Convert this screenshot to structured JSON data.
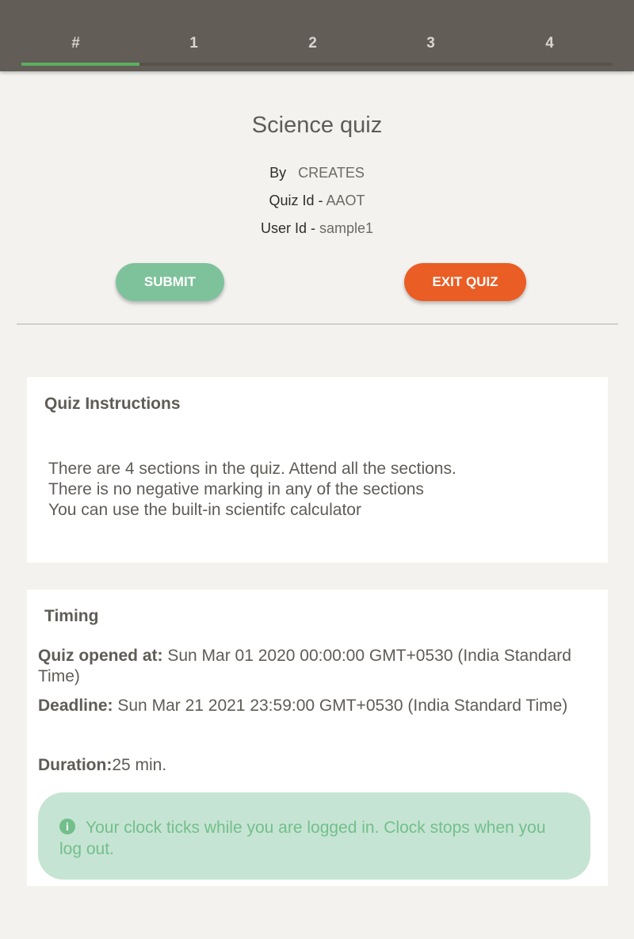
{
  "tabs": [
    {
      "label": "#",
      "active": true
    },
    {
      "label": "1",
      "active": false
    },
    {
      "label": "2",
      "active": false
    },
    {
      "label": "3",
      "active": false
    },
    {
      "label": "4",
      "active": false
    }
  ],
  "quiz": {
    "title": "Science quiz",
    "by_label": "By",
    "by_value": "CREATES",
    "quiz_id_label": "Quiz Id -",
    "quiz_id_value": "AAOT",
    "user_id_label": "User Id -",
    "user_id_value": "sample1"
  },
  "actions": {
    "submit_label": "SUBMIT",
    "exit_label": "EXIT QUIZ"
  },
  "instructions": {
    "heading": "Quiz Instructions",
    "lines": [
      "There are 4 sections in the quiz. Attend all the sections.",
      "There is no negative marking in any of the sections",
      "You can use the built-in scientifc calculator"
    ]
  },
  "timing": {
    "heading": "Timing",
    "opened_label": "Quiz opened at:",
    "opened_value": "Sun Mar 01 2020 00:00:00 GMT+0530 (India Standard Time)",
    "deadline_label": "Deadline:",
    "deadline_value": "Sun Mar 21 2021 23:59:00 GMT+0530 (India Standard Time)",
    "duration_label": "Duration:",
    "duration_value": "25 min.",
    "notice_icon": "i",
    "notice_text": "Your clock ticks while you are logged in. Clock stops when you log out."
  },
  "colors": {
    "header_bg": "#625d56",
    "tab_indicator": "#5cae5f",
    "submit_bg": "#7ec29b",
    "exit_bg": "#ea5d25",
    "notice_bg": "#c6e4d3",
    "notice_text": "#72bf8c"
  }
}
